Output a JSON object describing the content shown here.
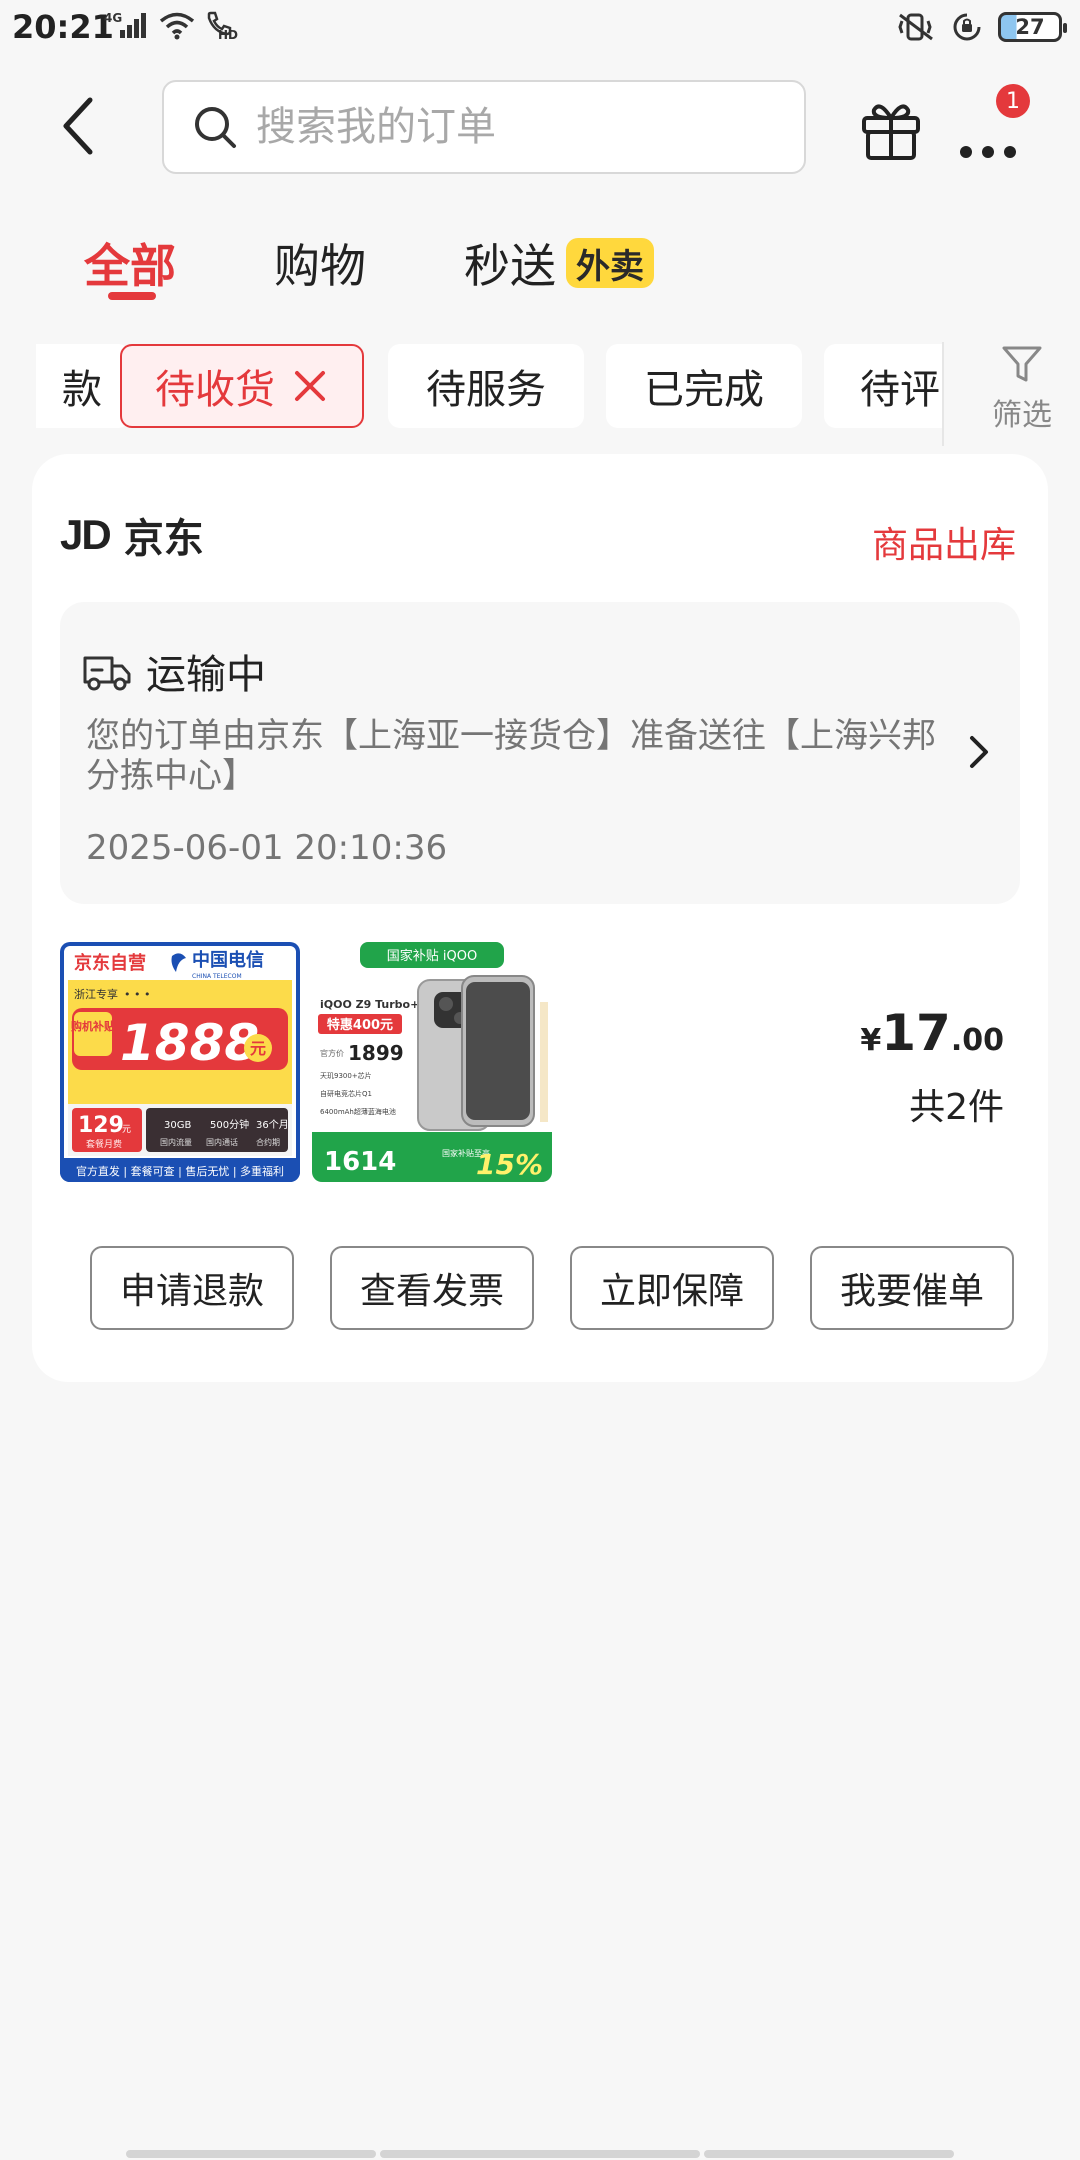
{
  "status_bar": {
    "time": "20:21",
    "network": "4G",
    "battery_level": "27"
  },
  "header": {
    "search_placeholder": "搜索我的订单",
    "notification_count": "1"
  },
  "main_tabs": [
    {
      "label": "全部",
      "active": true
    },
    {
      "label": "购物",
      "active": false
    },
    {
      "label": "秒送",
      "active": false,
      "badge": "外卖"
    }
  ],
  "filter_chips": [
    {
      "label": "款",
      "active": false
    },
    {
      "label": "待收货",
      "active": true
    },
    {
      "label": "待服务",
      "active": false
    },
    {
      "label": "已完成",
      "active": false
    },
    {
      "label": "待评",
      "active": false
    }
  ],
  "filter_button_label": "筛选",
  "order": {
    "store_name": "京东",
    "store_logo_text": "JD",
    "status": "商品出库",
    "logistics": {
      "title": "运输中",
      "description": "您的订单由京东【上海亚一接货仓】准备送往【上海兴邦分拣中心】",
      "time": "2025-06-01 20:10:36"
    },
    "products": [
      {
        "brand_label": "京东自营",
        "carrier": "中国电信",
        "carrier_en": "CHINA TELECOM",
        "region_label": "浙江专享",
        "subsidy_label": "购机补贴",
        "subsidy_amount": "1888",
        "subsidy_unit": "元",
        "monthly_fee": "129",
        "monthly_fee_unit": "元",
        "fee_note": "套餐月费",
        "data_label": "30GB",
        "data_note": "国内流量",
        "minutes_label": "500分钟",
        "minutes_note": "国内通话",
        "contract_label": "36个月",
        "contract_note": "合约期",
        "footer_text": "官方直发 | 套餐可查 | 售后无忧 | 多重福利"
      },
      {
        "top_banner": "国家补贴 iQOO",
        "model": "iQOO Z9 Turbo+",
        "discount_tag": "特惠400元",
        "original_price_label": "官方价",
        "original_price": "1899",
        "spec1": "天玑9300+芯片",
        "spec2": "自研电竞芯片Q1",
        "spec3": "6400mAh超薄蓝海电池",
        "final_price": "1614",
        "subsidy_text": "国家补贴至高",
        "subsidy_percent": "15%"
      }
    ],
    "price_currency": "¥",
    "price_int": "17",
    "price_dec": ".00",
    "item_count": "共2件",
    "actions": [
      "申请退款",
      "查看发票",
      "立即保障",
      "我要催单"
    ]
  },
  "colors": {
    "accent": "#e4393c",
    "waimai_badge": "#ffd83d",
    "card_bg": "#ffffff",
    "page_bg": "#f7f7f7"
  }
}
